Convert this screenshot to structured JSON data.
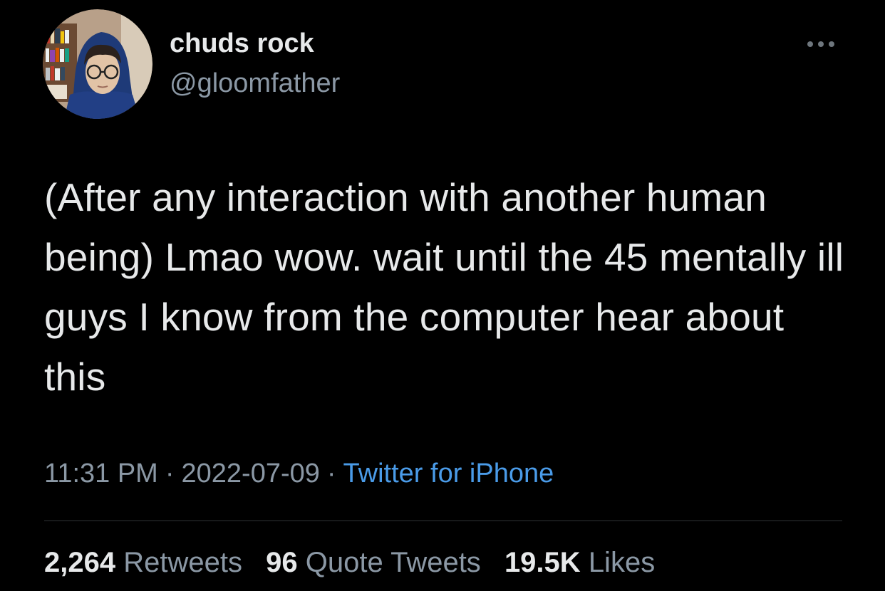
{
  "tweet": {
    "display_name": "chuds rock",
    "handle": "@gloomfather",
    "text": "(After any interaction with another human being) Lmao wow. wait until the 45 mentally ill guys I know from the computer hear about this",
    "time": "11:31 PM",
    "date": "2022-07-09",
    "separator": "·",
    "source": "Twitter for iPhone"
  },
  "stats": {
    "retweets_count": "2,264",
    "retweets_label": "Retweets",
    "quotes_count": "96",
    "quotes_label": "Quote Tweets",
    "likes_count": "19.5K",
    "likes_label": "Likes"
  },
  "icons": {
    "more": "more-horizontal-icon",
    "avatar": "profile-avatar"
  },
  "colors": {
    "background": "#000000",
    "text_primary": "#e7e9ea",
    "text_secondary": "#8b98a5",
    "link": "#4a9be8",
    "divider": "#2f3336"
  }
}
